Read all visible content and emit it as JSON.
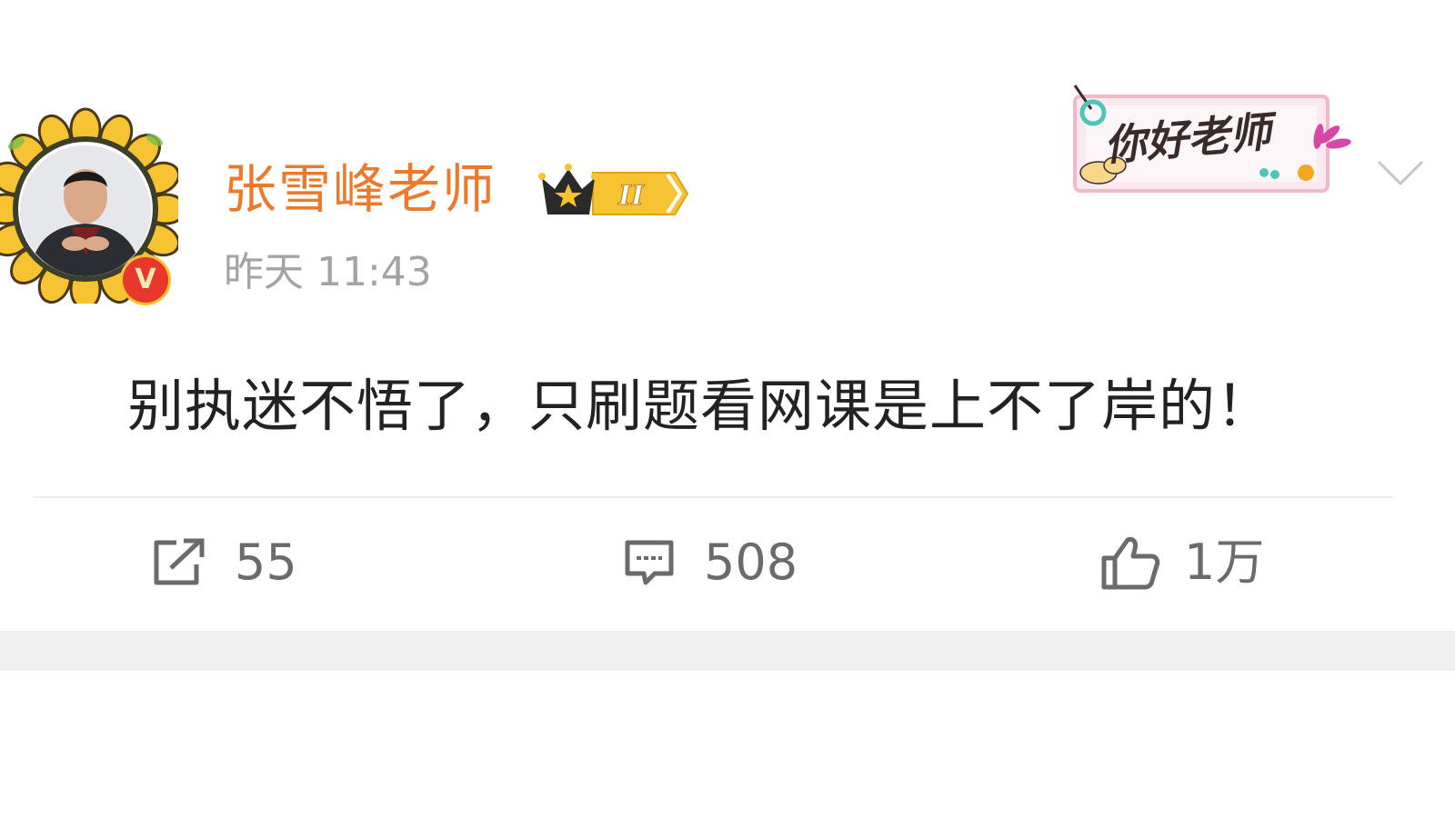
{
  "post": {
    "author": {
      "name": "张雪峰老师",
      "verified_badge": "V",
      "level_badge": "II"
    },
    "timestamp": "昨天 11:43",
    "sticker_text": "你好老师",
    "text": "别执迷不悟了，只刷题看网课是上不了岸的！",
    "actions": {
      "share_count": "55",
      "comment_count": "508",
      "like_count": "1万"
    }
  },
  "colors": {
    "username": "#ec7a2c",
    "timestamp": "#a3a3a3",
    "body_text": "#222222",
    "action_text": "#6b6b6b",
    "verified": "#e8382b",
    "band": "#efefef"
  },
  "icons": [
    "share-icon",
    "comment-icon",
    "thumbs-up-icon",
    "chevron-down-icon",
    "crown-icon"
  ]
}
